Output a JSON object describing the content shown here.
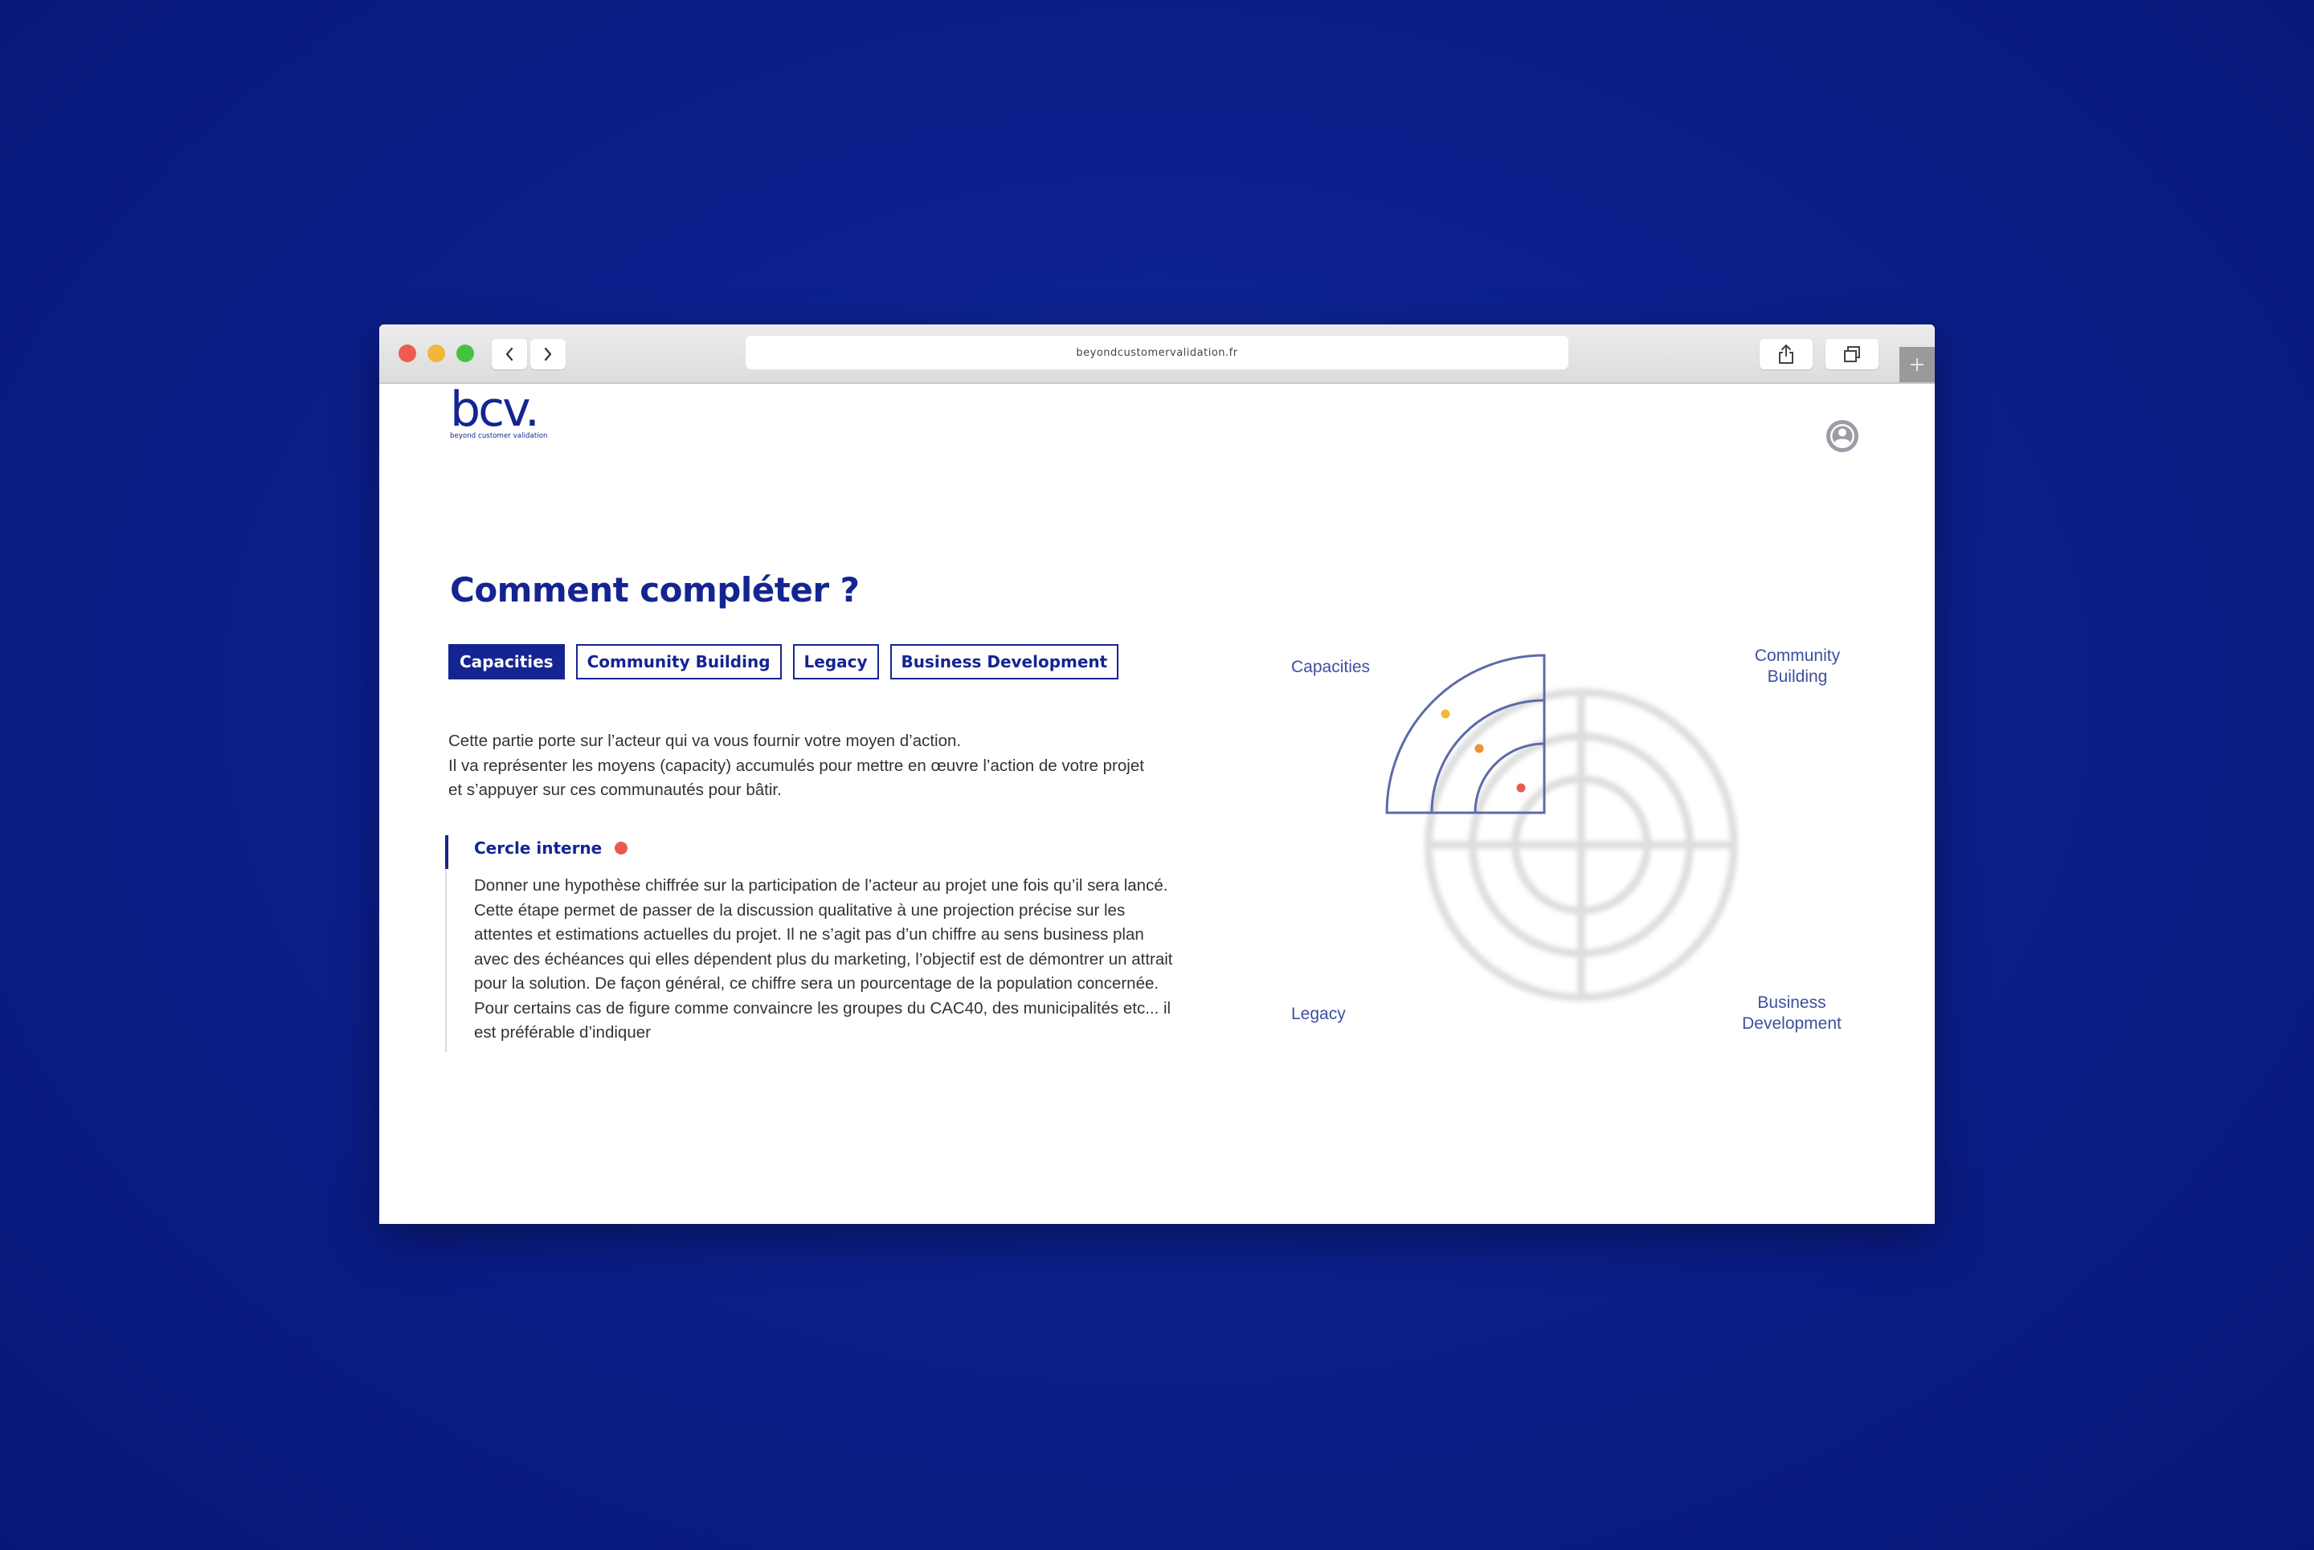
{
  "browser": {
    "url": "beyondcustomervalidation.fr"
  },
  "logo": {
    "wordmark": "bcv.",
    "tagline": "beyond customer validation"
  },
  "page": {
    "title": "Comment compléter ?",
    "tabs": [
      {
        "label": "Capacities",
        "active": true
      },
      {
        "label": "Community Building",
        "active": false
      },
      {
        "label": "Legacy",
        "active": false
      },
      {
        "label": "Business Development",
        "active": false
      }
    ],
    "description": [
      "Cette partie porte sur l’acteur qui va vous fournir votre moyen d’action.",
      "Il va représenter les moyens (capacity) accumulés pour mettre en œuvre l’action de votre projet et s’appuyer sur ces communautés pour bâtir."
    ],
    "section": {
      "title": "Cercle interne",
      "body": "Donner une hypothèse chiffrée sur la participation de l’acteur au projet une fois qu’il sera lancé. Cette étape permet de passer de la discussion qualitative à une projection précise sur les attentes et estimations actuelles du projet. Il ne s’agit pas d’un chiffre au sens business plan avec des échéances qui elles dépendent plus du marketing, l’objectif est de démontrer un attrait pour la solution. De façon général, ce chiffre sera un pourcentage de la population concernée. Pour certains cas de figure comme convaincre les groupes du CAC40, des municipalités etc... il est préférable d’indiquer"
    }
  },
  "diagram": {
    "quadrants": {
      "top_left": "Capacities",
      "top_right": [
        "Community",
        "Building"
      ],
      "bottom_left": "Legacy",
      "bottom_right": [
        "Business",
        "Development"
      ]
    },
    "points": [
      {
        "ring": "outer",
        "color": "#f2b63a"
      },
      {
        "ring": "middle",
        "color": "#f0913a"
      },
      {
        "ring": "inner",
        "color": "#e85a4f"
      }
    ]
  },
  "colors": {
    "brand": "#142591",
    "background": "#0b1f8c",
    "point_red": "#e85a4f",
    "point_orange": "#f0913a",
    "point_yellow": "#f2b63a"
  },
  "icons": [
    "chevron-left-icon",
    "chevron-right-icon",
    "share-icon",
    "tabs-icon",
    "plus-icon",
    "user-icon"
  ]
}
